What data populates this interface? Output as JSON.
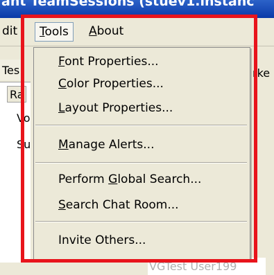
{
  "window": {
    "title": "ant TeamSessions (stuev1.instanc"
  },
  "menubar": {
    "items": [
      {
        "label_before": "",
        "mnemonic": "",
        "label_after": "dit"
      },
      {
        "label_before": "",
        "mnemonic": "T",
        "label_after": "ools"
      },
      {
        "label_before": "",
        "mnemonic": "A",
        "label_after": "bout"
      }
    ]
  },
  "background": {
    "tab_fragment": "Tes",
    "column_fragment": "Ra",
    "row_fragments": [
      "Vo",
      "Su"
    ],
    "right_fragment": "rke",
    "user_row": "VGTest User199"
  },
  "tools_menu": {
    "items": [
      {
        "before": "",
        "mnemonic": "F",
        "after": "ont Properties..."
      },
      {
        "before": "",
        "mnemonic": "C",
        "after": "olor Properties..."
      },
      {
        "before": "",
        "mnemonic": "L",
        "after": "ayout Properties..."
      },
      {
        "before": "",
        "mnemonic": "M",
        "after": "anage Alerts..."
      },
      {
        "before": "Perform ",
        "mnemonic": "G",
        "after": "lobal Search..."
      },
      {
        "before": "",
        "mnemonic": "S",
        "after": "earch Chat Room..."
      },
      {
        "before": "Invite Others...",
        "mnemonic": "",
        "after": ""
      }
    ]
  },
  "colors": {
    "highlight": "#e8141c",
    "menu_bg": "#ece9d8",
    "titlebar": "#0a3aa8"
  }
}
